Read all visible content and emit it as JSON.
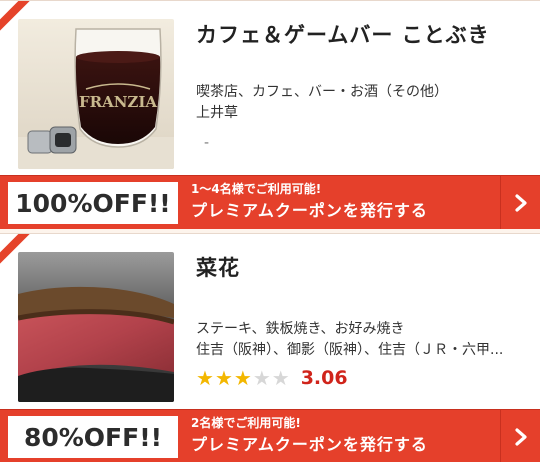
{
  "cards": [
    {
      "name": "カフェ＆ゲームバー ことぶき",
      "genre": "喫茶店、カフェ、バー・お酒（その他）",
      "area": "上井草",
      "rating_placeholder": "-",
      "discount": "100%OFF!!",
      "coupon_condition": "1〜4名様でご利用可能!",
      "coupon_action": "プレミアムクーポンを発行する",
      "thumbnail_icon": "wine-glass-photo"
    },
    {
      "name": "菜花",
      "genre": "ステーキ、鉄板焼き、お好み焼き",
      "area": "住吉（阪神）、御影（阪神）、住吉（ＪＲ・六甲...",
      "rating": {
        "stars_filled": 3,
        "stars_total": 5,
        "score": "3.06"
      },
      "discount": "80%OFF!!",
      "coupon_condition": "2名様でご利用可能!",
      "coupon_action": "プレミアムクーポンを発行する",
      "thumbnail_icon": "steak-photo"
    }
  ],
  "colors": {
    "accent": "#e5402b",
    "star": "#f3b700",
    "score": "#d0241b"
  }
}
